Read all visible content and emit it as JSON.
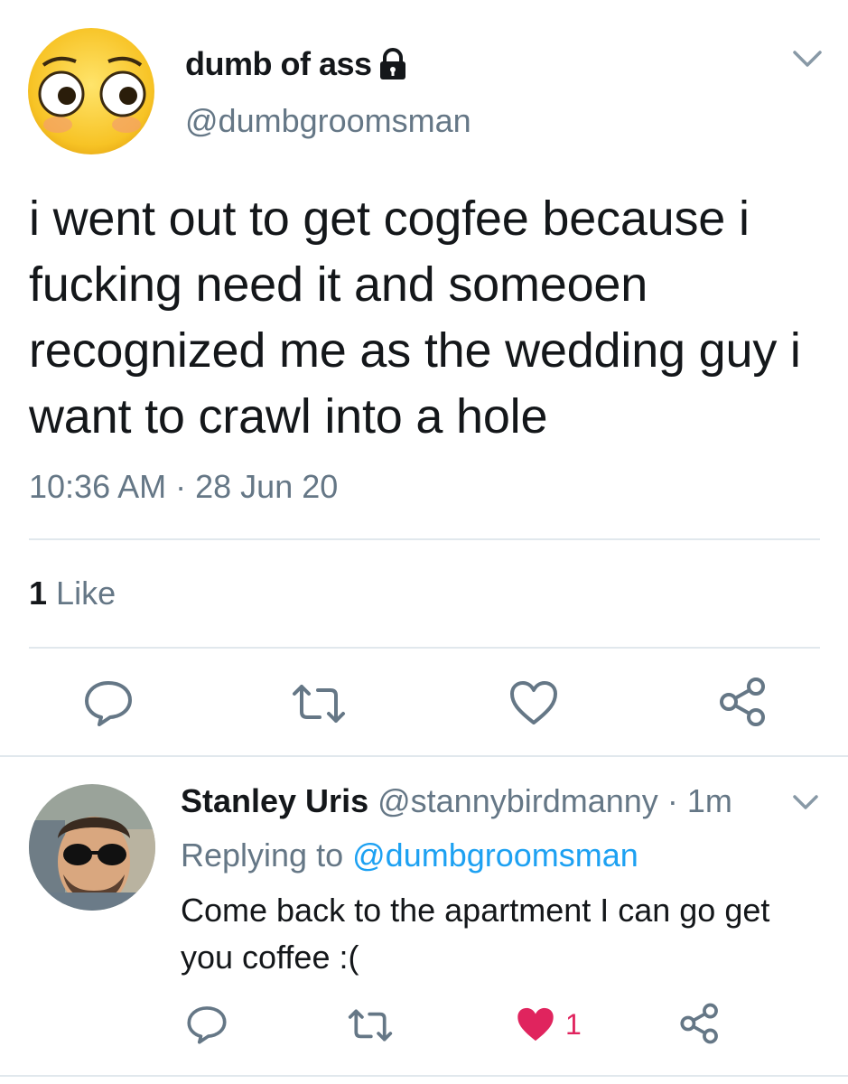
{
  "colors": {
    "text": "#14171a",
    "secondary": "#657786",
    "link": "#1da1f2",
    "divider": "#e1e8ed",
    "liked": "#e0245e"
  },
  "main_tweet": {
    "display_name": "dumb of ass",
    "protected_icon": "lock-icon",
    "handle": "@dumbgroomsman",
    "text": "i went out to get cogfee because i fucking need it and someoen recognized me as the wedding guy i want to crawl into a hole",
    "time": "10:36 AM",
    "separator": "·",
    "date": "28 Jun 20",
    "like_count": "1",
    "like_label": "Like",
    "actions": [
      "reply-icon",
      "retweet-icon",
      "heart-icon",
      "share-icon"
    ]
  },
  "reply": {
    "display_name": "Stanley Uris",
    "handle": "@stannybirdmanny",
    "separator": "·",
    "age": "1m",
    "replying_prefix": "Replying to",
    "replying_to": "@dumbgroomsman",
    "text": "Come back to the apartment I can go get you coffee :(",
    "like_count": "1",
    "liked": true,
    "actions": [
      "reply-icon",
      "retweet-icon",
      "heart-filled-icon",
      "share-icon"
    ]
  }
}
